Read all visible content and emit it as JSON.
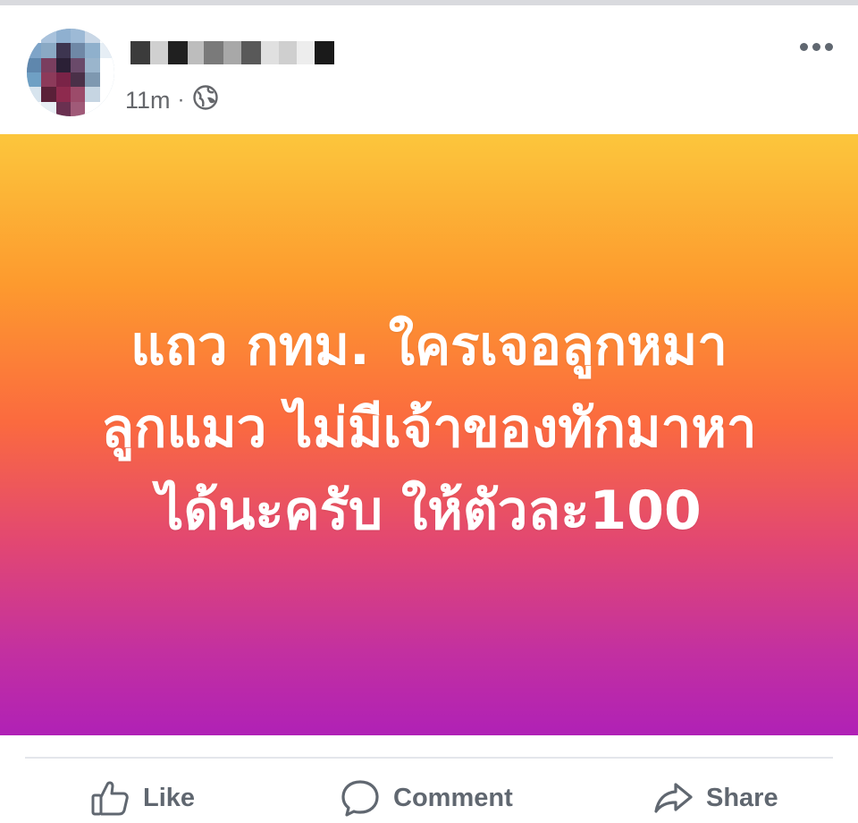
{
  "post": {
    "timestamp": "11m",
    "separator": "·",
    "audience_icon": "globe-icon",
    "more_icon": "more-options-icon",
    "message_lines": [
      "แถว กทม. ใครเจอลูกหมา",
      "ลูกแมว ไม่มีเจ้าของทักมาหา",
      "ได้นะครับ ให้ตัวละ100"
    ],
    "background_colors": [
      "#fcc63c",
      "#fb6a3f",
      "#b021b6"
    ]
  },
  "actions": {
    "like": {
      "label": "Like",
      "icon": "thumbs-up-icon"
    },
    "comment": {
      "label": "Comment",
      "icon": "comment-bubble-icon"
    },
    "share": {
      "label": "Share",
      "icon": "share-arrow-icon"
    }
  },
  "colors": {
    "meta_text": "#65676b",
    "action_text": "#606770"
  }
}
